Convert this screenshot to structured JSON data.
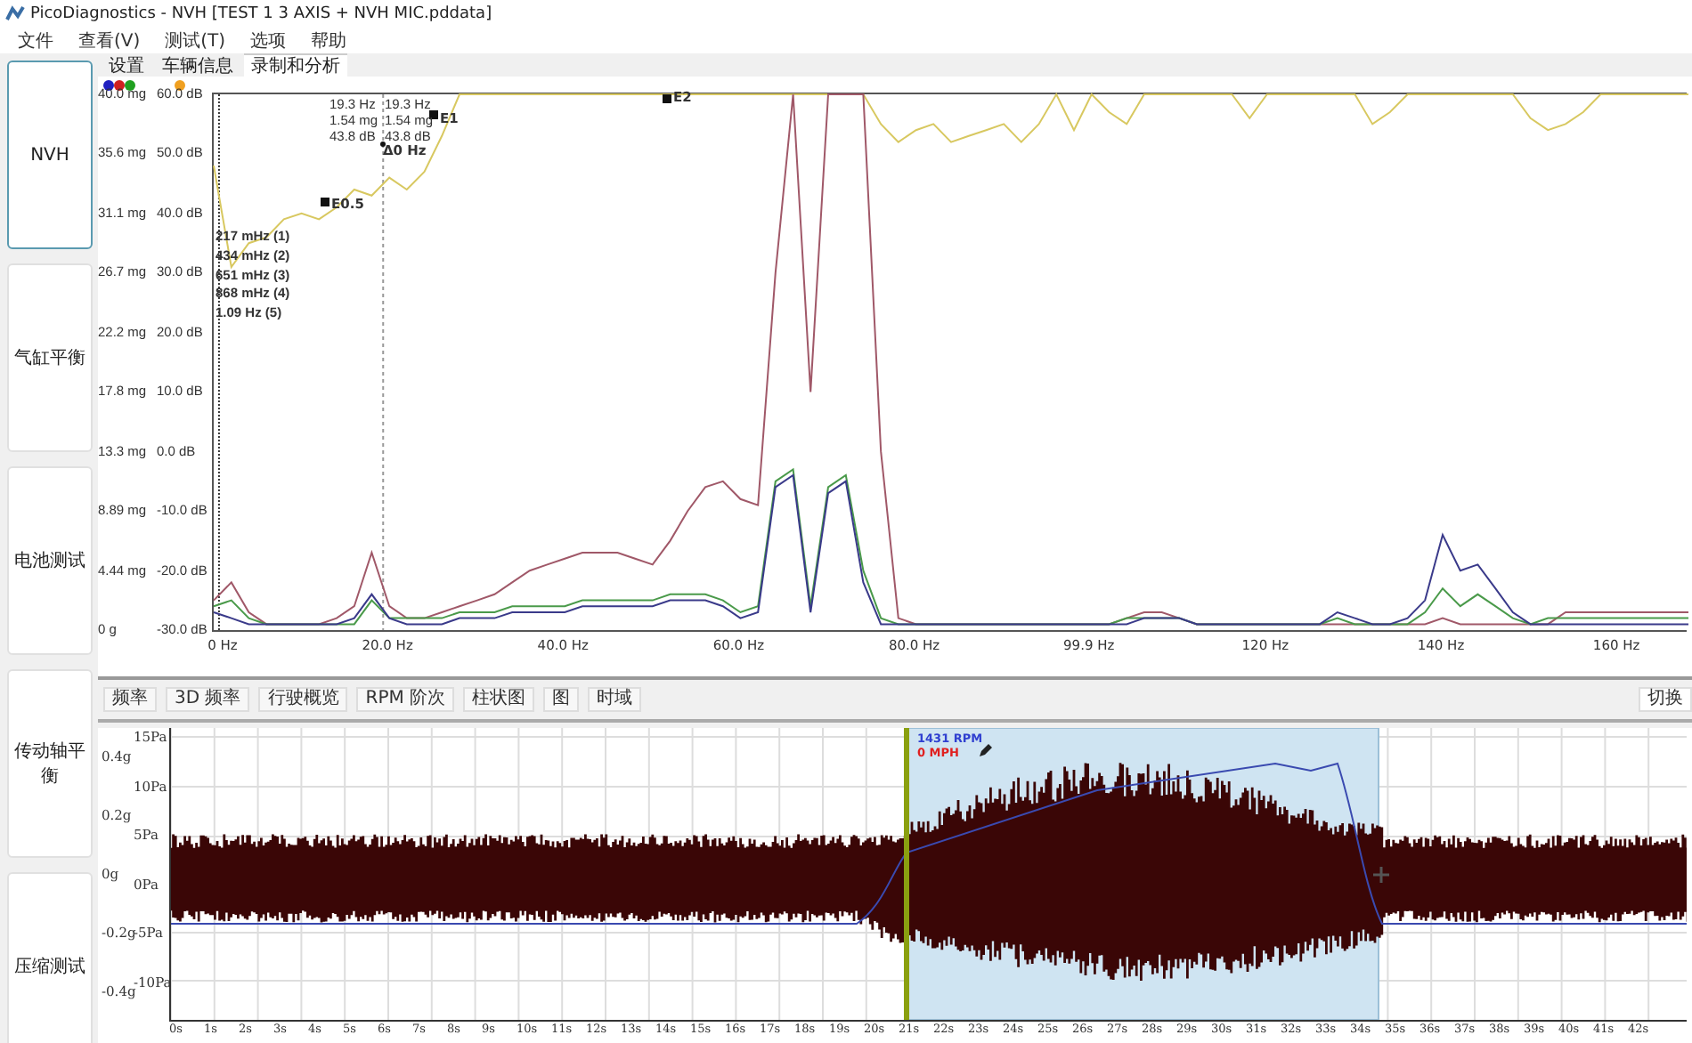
{
  "window": {
    "title": "PicoDiagnostics - NVH [TEST 1 3 AXIS + NVH MIC.pddata]"
  },
  "menu": [
    "文件",
    "查看(V)",
    "测试(T)",
    "选项",
    "帮助"
  ],
  "sidebar": {
    "items": [
      {
        "label": "NVH",
        "selected": true
      },
      {
        "label": "气缸平衡",
        "selected": false
      },
      {
        "label": "电池测试",
        "selected": false
      },
      {
        "label": "传动轴平衡",
        "selected": false
      },
      {
        "label": "压缩测试",
        "selected": false
      }
    ]
  },
  "tabs": [
    {
      "label": "设置",
      "selected": false
    },
    {
      "label": "车辆信息",
      "selected": false
    },
    {
      "label": "录制和分析",
      "selected": true
    }
  ],
  "spectrum": {
    "channels": [
      {
        "color": "#2020c0"
      },
      {
        "color": "#d02020"
      },
      {
        "color": "#20a020"
      },
      {
        "color": "#f0a020"
      }
    ],
    "mg_labels": [
      "40.0 mg",
      "35.6 mg",
      "31.1 mg",
      "26.7 mg",
      "22.2 mg",
      "17.8 mg",
      "13.3 mg",
      "8.89 mg",
      "4.44 mg",
      "0 g"
    ],
    "chart_data": {
      "type": "line",
      "xlim": [
        0,
        168
      ],
      "ref_lines": [
        {
          "axis": "x",
          "value": 19.3
        },
        {
          "axis": "x",
          "value": 0.6
        }
      ],
      "ylim": [
        -30,
        60
      ],
      "x": [
        0,
        2,
        4,
        6,
        8,
        10,
        12,
        14,
        16,
        18,
        20,
        22,
        24,
        26,
        28,
        30,
        32,
        34,
        36,
        38,
        40,
        42,
        44,
        46,
        48,
        50,
        52,
        54,
        56,
        58,
        60,
        62,
        64,
        66,
        68,
        70,
        72,
        74,
        76,
        78,
        80,
        82,
        84,
        86,
        88,
        90,
        92,
        94,
        96,
        98,
        100,
        102,
        104,
        106,
        108,
        110,
        112,
        114,
        116,
        118,
        120,
        122,
        124,
        126,
        128,
        130,
        132,
        134,
        136,
        138,
        140,
        142,
        144,
        146,
        148,
        150,
        152,
        154,
        156,
        158,
        160,
        162,
        164,
        166,
        168
      ],
      "xticks": [
        {
          "value": 0,
          "label": "0 Hz"
        },
        {
          "value": 20,
          "label": "20.0 Hz"
        },
        {
          "value": 40,
          "label": "40.0 Hz"
        },
        {
          "value": 60,
          "label": "60.0 Hz"
        },
        {
          "value": 80,
          "label": "80.0 Hz"
        },
        {
          "value": 99.9,
          "label": "99.9 Hz"
        },
        {
          "value": 120,
          "label": "120 Hz"
        },
        {
          "value": 140,
          "label": "140 Hz"
        },
        {
          "value": 160,
          "label": "160 Hz"
        }
      ],
      "yticks": [
        {
          "value": 60,
          "label": "60.0 dB"
        },
        {
          "value": 50,
          "label": "50.0 dB"
        },
        {
          "value": 40,
          "label": "40.0 dB"
        },
        {
          "value": 30,
          "label": "30.0 dB"
        },
        {
          "value": 20,
          "label": "20.0 dB"
        },
        {
          "value": 10,
          "label": "10.0 dB"
        },
        {
          "value": 0,
          "label": "0.0 dB"
        },
        {
          "value": -10,
          "label": "-10.0 dB"
        },
        {
          "value": -20,
          "label": "-20.0 dB"
        },
        {
          "value": -30,
          "label": "-30.0 dB"
        }
      ],
      "series": [
        {
          "color": "#d8c860",
          "values": [
            48,
            31,
            35,
            36,
            39,
            40,
            39,
            41,
            44,
            43,
            46,
            44,
            47,
            53,
            60,
            60,
            60,
            60,
            60,
            60,
            60,
            60,
            60,
            60,
            60,
            60,
            60,
            60,
            60,
            60,
            60,
            60,
            60,
            60,
            60,
            60,
            null,
            60,
            55,
            52,
            54,
            55,
            52,
            53,
            54,
            55,
            52,
            55,
            60,
            54,
            60,
            57,
            55,
            60,
            60,
            60,
            60,
            60,
            60,
            56,
            60,
            60,
            60,
            60,
            60,
            60,
            55,
            57,
            60,
            60,
            60,
            60,
            60,
            60,
            60,
            56,
            54,
            55,
            57,
            60,
            60,
            60,
            60,
            60,
            60
          ]
        },
        {
          "color": "#a05868",
          "values": [
            -25,
            -22,
            -27,
            -29,
            -29,
            -29,
            -29,
            -28,
            -26,
            -17,
            -26,
            -28,
            -28,
            -27,
            -26,
            -25,
            -24,
            -22,
            -20,
            -19,
            -18,
            -17,
            -17,
            -17,
            -18,
            -19,
            -15,
            -10,
            -6,
            -5,
            -8,
            -9,
            30,
            60,
            10,
            60,
            60,
            60,
            0,
            -28,
            -29,
            -29,
            -29,
            -29,
            -29,
            -29,
            -29,
            -29,
            -29,
            -29,
            -29,
            -29,
            -28,
            -27,
            -27,
            -28,
            -29,
            -29,
            -29,
            -29,
            -29,
            -29,
            -29,
            -29,
            -29,
            -29,
            -29,
            -29,
            -29,
            -29,
            -28,
            -29,
            -29,
            -29,
            -29,
            -29,
            -29,
            -27,
            -27,
            -27,
            -27,
            -27,
            -27,
            -27,
            -27
          ]
        },
        {
          "color": "#4a9a4a",
          "values": [
            -26,
            -25,
            -28,
            -29,
            -29,
            -29,
            -29,
            -29,
            -29,
            -25,
            -28,
            -28,
            -28,
            -28,
            -27,
            -27,
            -27,
            -26,
            -26,
            -26,
            -26,
            -25,
            -25,
            -25,
            -25,
            -25,
            -24,
            -24,
            -24,
            -25,
            -27,
            -26,
            -5,
            -3,
            -26,
            -6,
            -4,
            -20,
            -28,
            -29,
            -29,
            -29,
            -29,
            -29,
            -29,
            -29,
            -29,
            -29,
            -29,
            -29,
            -29,
            -29,
            -28,
            -28,
            -28,
            -28,
            -29,
            -29,
            -29,
            -29,
            -29,
            -29,
            -29,
            -29,
            -28,
            -29,
            -29,
            -29,
            -29,
            -27,
            -23,
            -26,
            -24,
            -26,
            -28,
            -29,
            -28,
            -28,
            -28,
            -28,
            -28,
            -28,
            -28,
            -28,
            -28
          ]
        },
        {
          "color": "#3a3a8a",
          "values": [
            -27,
            -28,
            -29,
            -29,
            -29,
            -29,
            -29,
            -29,
            -28,
            -24,
            -28,
            -29,
            -29,
            -29,
            -28,
            -28,
            -28,
            -27,
            -27,
            -27,
            -27,
            -26,
            -26,
            -26,
            -26,
            -26,
            -25,
            -25,
            -25,
            -26,
            -28,
            -27,
            -6,
            -4,
            -27,
            -7,
            -5,
            -22,
            -29,
            -29,
            -29,
            -29,
            -29,
            -29,
            -29,
            -29,
            -29,
            -29,
            -29,
            -29,
            -29,
            -29,
            -29,
            -28,
            -28,
            -28,
            -29,
            -29,
            -29,
            -29,
            -29,
            -29,
            -29,
            -29,
            -27,
            -28,
            -29,
            -29,
            -28,
            -25,
            -14,
            -20,
            -19,
            -23,
            -27,
            -29,
            -29,
            -29,
            -29,
            -29,
            -29,
            -29,
            -29,
            -29,
            -29
          ]
        }
      ]
    },
    "cursor_readouts": [
      [
        "19.3 Hz",
        "1.54 mg",
        "43.8 dB"
      ],
      [
        "19.3 Hz",
        "1.54 mg",
        "43.8 dB"
      ]
    ],
    "cursor_delta": "Δ0 Hz",
    "markers": [
      "E0.5",
      "E1",
      "E2"
    ],
    "harmonics": [
      "217 mHz (1)",
      "434 mHz (2)",
      "651 mHz (3)",
      "868 mHz (4)",
      "1.09 Hz (5)"
    ]
  },
  "toolbar": {
    "buttons": [
      "频率",
      "3D 频率",
      "行驶概览",
      "RPM 阶次",
      "柱状图",
      "图",
      "时域"
    ],
    "right_button": "切换"
  },
  "waveform": {
    "g_labels": [
      "0.4g",
      "0.2g",
      "0g",
      "-0.2g",
      "-0.4g"
    ],
    "pa_labels": [
      "15Pa",
      "10Pa",
      "5Pa",
      "0Pa",
      "-5Pa",
      "-10Pa"
    ],
    "time_labels": [
      "0s",
      "1s",
      "2s",
      "3s",
      "4s",
      "5s",
      "6s",
      "7s",
      "8s",
      "9s",
      "10s",
      "11s",
      "12s",
      "13s",
      "14s",
      "15s",
      "16s",
      "17s",
      "18s",
      "19s",
      "20s",
      "21s",
      "22s",
      "23s",
      "24s",
      "25s",
      "26s",
      "27s",
      "28s",
      "29s",
      "30s",
      "31s",
      "32s",
      "33s",
      "34s",
      "35s",
      "36s",
      "37s",
      "38s",
      "39s",
      "40s",
      "41s",
      "42s"
    ],
    "rpm": "1431 RPM",
    "speed": "0 MPH"
  }
}
